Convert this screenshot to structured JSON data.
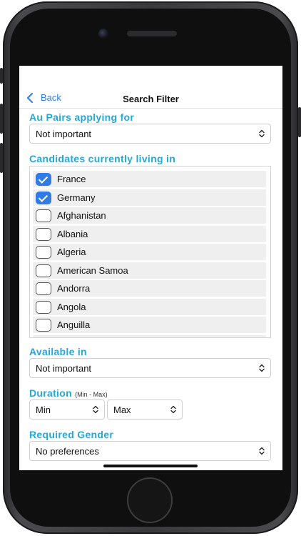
{
  "nav": {
    "back_label": "Back",
    "title": "Search Filter"
  },
  "sections": {
    "applying_for": {
      "label": "Au Pairs applying for",
      "value": "Not important"
    },
    "living_in": {
      "label": "Candidates currently living in",
      "items": [
        {
          "label": "France",
          "checked": true
        },
        {
          "label": "Germany",
          "checked": true
        },
        {
          "label": "Afghanistan",
          "checked": false
        },
        {
          "label": "Albania",
          "checked": false
        },
        {
          "label": "Algeria",
          "checked": false
        },
        {
          "label": "American Samoa",
          "checked": false
        },
        {
          "label": "Andorra",
          "checked": false
        },
        {
          "label": "Angola",
          "checked": false
        },
        {
          "label": "Anguilla",
          "checked": false
        }
      ]
    },
    "available_in": {
      "label": "Available in",
      "value": "Not important"
    },
    "duration": {
      "label": "Duration",
      "hint": "(Min - Max)",
      "min": "Min",
      "max": "Max"
    },
    "gender": {
      "label": "Required Gender",
      "value": "No preferences"
    }
  },
  "colors": {
    "accent": "#25a7d8",
    "link": "#2f7ce8",
    "checkbox_on": "#2f7ce8"
  }
}
